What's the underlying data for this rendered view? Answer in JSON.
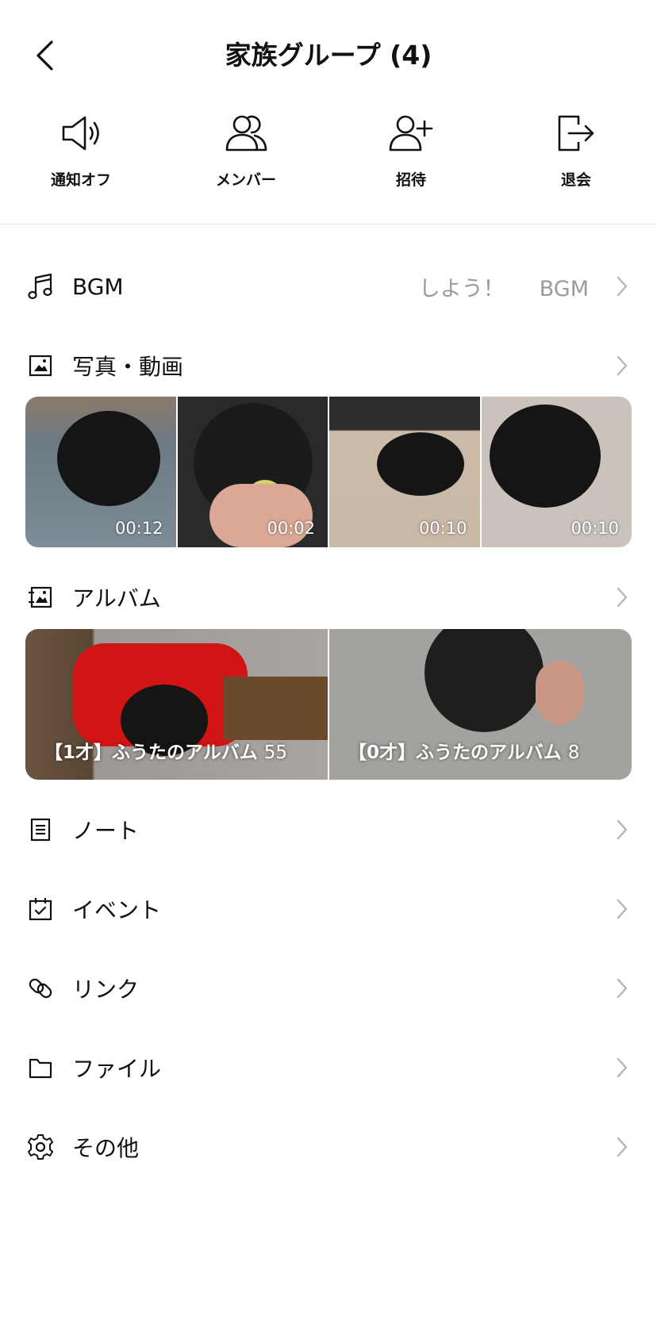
{
  "header": {
    "title": "家族グループ (4)"
  },
  "actions": [
    {
      "label": "通知オフ",
      "icon": "speaker-icon"
    },
    {
      "label": "メンバー",
      "icon": "members-icon"
    },
    {
      "label": "招待",
      "icon": "add-user-icon"
    },
    {
      "label": "退会",
      "icon": "leave-icon"
    }
  ],
  "bgm": {
    "label": "BGM",
    "prompt": "しよう！",
    "suffix": "BGM"
  },
  "photos": {
    "label": "写真・動画",
    "items": [
      {
        "duration": "00:12"
      },
      {
        "duration": "00:02"
      },
      {
        "duration": "00:10"
      },
      {
        "duration": "00:10"
      }
    ]
  },
  "albums": {
    "label": "アルバム",
    "items": [
      {
        "title": "【1才】ふうたのアルバム",
        "count": "55"
      },
      {
        "title": "【0才】ふうたのアルバム",
        "count": "8"
      }
    ]
  },
  "menu": {
    "note": "ノート",
    "event": "イベント",
    "link": "リンク",
    "file": "ファイル",
    "other": "その他"
  },
  "colors": {
    "text": "#111111",
    "muted": "#9a9a9a",
    "divider": "#e6e6e6",
    "chevron": "#b5b5b5"
  }
}
